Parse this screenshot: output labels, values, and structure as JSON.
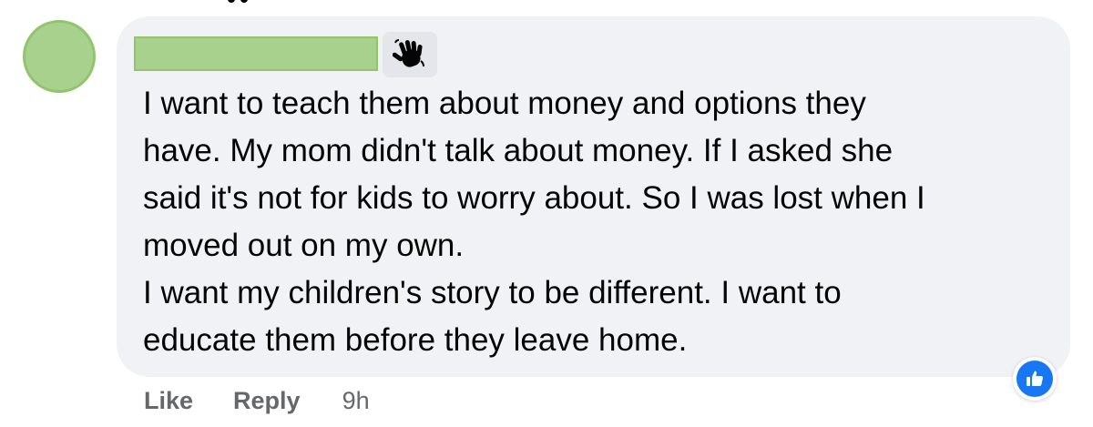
{
  "comment": {
    "author_name": "",
    "text_lines": [
      "I want to teach them about money and options they",
      "have. My mom didn't talk about money. If I asked she",
      "said it's not for kids to worry about. So I was lost when I",
      "moved out on my own.",
      "I want my children's story to be different. I want to",
      "educate them before they leave home."
    ],
    "author_badge_icon": "waving-hand-icon",
    "reaction_icon": "thumbs-up-icon"
  },
  "actions": {
    "like_label": "Like",
    "reply_label": "Reply",
    "timestamp": "9h"
  },
  "colors": {
    "bubble_bg": "#f0f2f5",
    "redaction": "#a9d18e",
    "action_text": "#65676b",
    "like_blue": "#1877f2"
  }
}
